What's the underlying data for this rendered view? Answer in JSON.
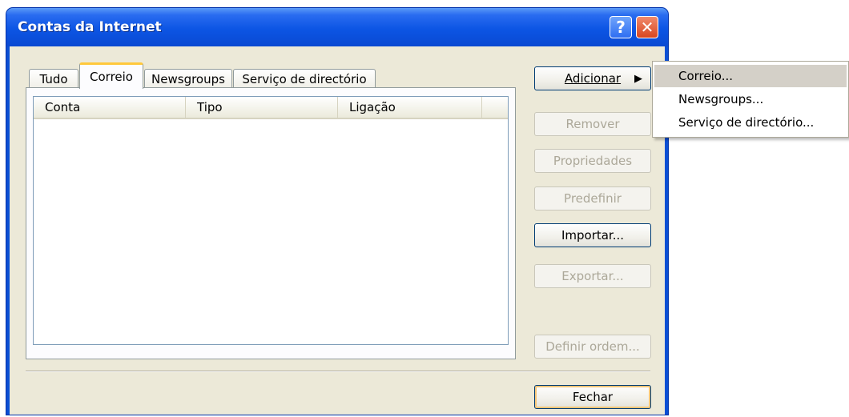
{
  "window": {
    "title": "Contas da Internet",
    "help_icon": "question-icon",
    "close_icon": "close-icon"
  },
  "tabs": [
    {
      "label": "Tudo"
    },
    {
      "label": "Correio",
      "active": true
    },
    {
      "label": "Newsgroups"
    },
    {
      "label": "Serviço de directório"
    }
  ],
  "list": {
    "columns": [
      "Conta",
      "Tipo",
      "Ligação"
    ],
    "rows": []
  },
  "buttons": {
    "add": "Adicionar",
    "remove": "Remover",
    "properties": "Propriedades",
    "set_default": "Predefinir",
    "import": "Importar...",
    "export": "Exportar...",
    "set_order": "Definir ordem...",
    "close": "Fechar"
  },
  "add_menu": {
    "items": [
      "Correio...",
      "Newsgroups...",
      "Serviço de directório..."
    ],
    "highlighted": "Correio..."
  },
  "colors": {
    "title_bar": "#0a4fd4",
    "dialog_bg": "#ece9d8",
    "tab_accent": "#ffc83c"
  }
}
